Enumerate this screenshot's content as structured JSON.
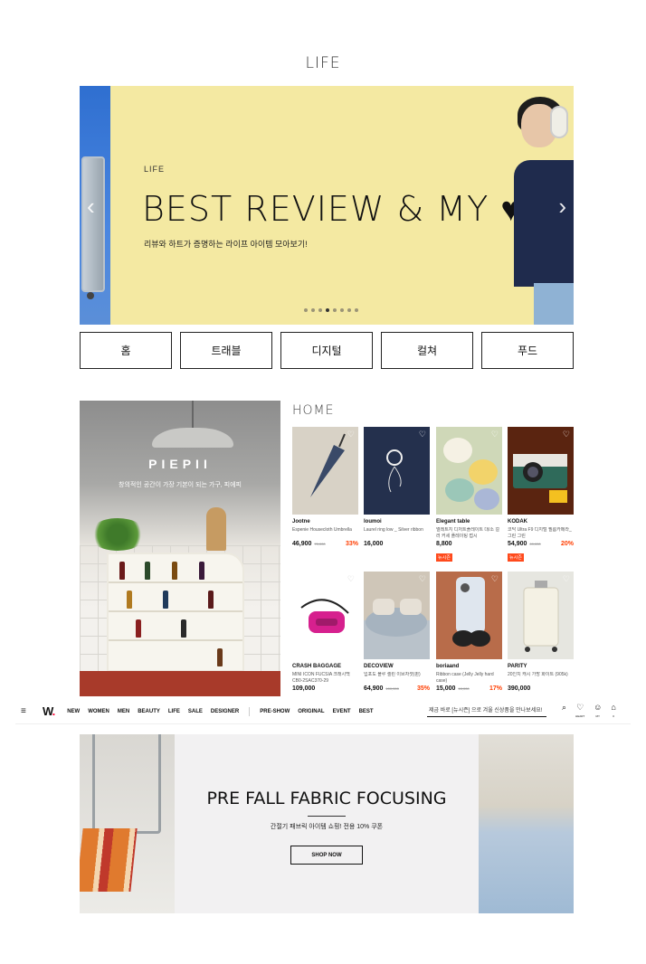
{
  "section": {
    "title": "LIFE"
  },
  "hero": {
    "tag": "LIFE",
    "headline": "BEST REVIEW & MY ♥",
    "subtitle": "리뷰와 하트가 증명하는 라이프 아이템 모아보기!",
    "prev_icon": "chevron-left-icon",
    "next_icon": "chevron-right-icon",
    "dots_total": 8,
    "dots_active": 3
  },
  "categories": [
    "홈",
    "트래블",
    "디지털",
    "컬쳐",
    "푸드"
  ],
  "brand_panel": {
    "logo": "PIEPII",
    "description": "창의적인 공간이 가장 기본이 되는 가구, 피에피"
  },
  "home": {
    "title": "HOME",
    "products": [
      {
        "brand": "Jootne",
        "name": "Espenie Housecloth Umbrella",
        "price": "46,900",
        "orig": "70,000",
        "discount": "33%",
        "badge": "",
        "color": "#d8d2c6"
      },
      {
        "brand": "loumoi",
        "name": "Laurel ring low _ Silver ribbon",
        "price": "16,000",
        "orig": "",
        "discount": "",
        "badge": "",
        "color": "#24304d"
      },
      {
        "brand": "Elegant table",
        "name": "엘레트지 디저트플레이트 대/소 컬러 커세 플레이팅 접시",
        "price": "8,800",
        "orig": "",
        "discount": "",
        "badge": "뉴시즌",
        "color": "#cfd8b8"
      },
      {
        "brand": "KODAK",
        "name": "코닥 Ultra F9 디지털 필름카메라_그린 그린",
        "price": "54,900",
        "orig": "69,000",
        "discount": "20%",
        "badge": "뉴시즌",
        "color": "#5a2410"
      },
      {
        "brand": "CRASH BAGGAGE",
        "name": "MINI ICON FUCSIA 크래시백 CB0-2SAC370-29",
        "price": "109,000",
        "orig": "",
        "discount": "",
        "badge": "",
        "color": "#ffffff"
      },
      {
        "brand": "DECOVIEW",
        "name": "입포도 블루 셀린 이브자셋(퀸)",
        "price": "64,900",
        "orig": "100,000",
        "discount": "35%",
        "badge": "",
        "color": "#cfc6b8"
      },
      {
        "brand": "boriaand",
        "name": "Ribbon case (Jelly Jelly hard case)",
        "price": "15,000",
        "orig": "18,000",
        "discount": "17%",
        "badge": "",
        "color": "#b86c4a"
      },
      {
        "brand": "PARITY",
        "name": "20인치 캐시 가방 화이트 (905k)",
        "price": "390,000",
        "orig": "",
        "discount": "",
        "badge": "",
        "color": "#e6e6e0"
      }
    ]
  },
  "nav": {
    "menu_icon": "menu-icon",
    "logo": "W.",
    "links": [
      "NEW",
      "WOMEN",
      "MEN",
      "BEAUTY",
      "LIFE",
      "SALE",
      "DESIGNER"
    ],
    "links2": [
      "PRE-SHOW",
      "ORIGINAL",
      "EVENT",
      "BEST"
    ],
    "search_placeholder": "제금 바로 [뉴시즌] 으로 겨울 신상품을 만나보세요!",
    "heart_label": "HEART",
    "my_label": "MY",
    "cart_count": "0"
  },
  "fabric": {
    "title": "PRE FALL FABRIC FOCUSING",
    "subtitle": "간절기 패브릭 아이템 쇼핑! 전용 10% 쿠폰",
    "button": "SHOP NOW"
  }
}
